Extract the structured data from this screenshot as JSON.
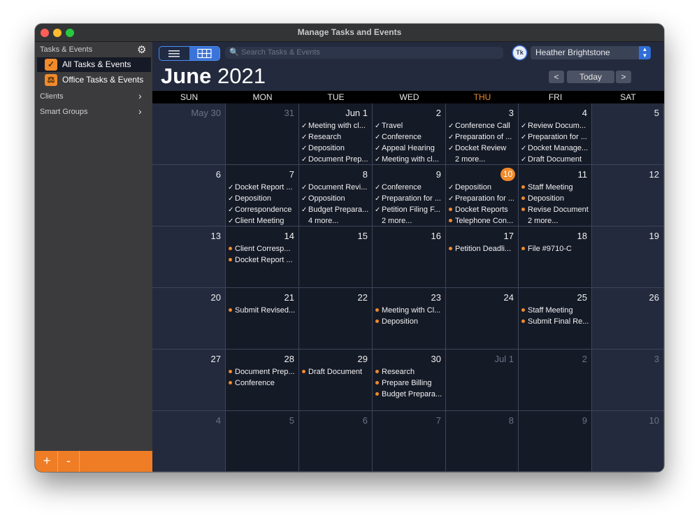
{
  "window": {
    "title": "Manage Tasks and Events"
  },
  "sidebar": {
    "header": "Tasks & Events",
    "items": [
      {
        "label": "All Tasks & Events",
        "icon": "checkbox-icon"
      },
      {
        "label": "Office Tasks & Events",
        "icon": "office-icon"
      }
    ],
    "groups": [
      {
        "label": "Clients"
      },
      {
        "label": "Smart Groups"
      }
    ],
    "add_label": "+",
    "remove_label": "-"
  },
  "toolbar": {
    "search_placeholder": "Search Tasks & Events",
    "user": "Heather Brightstone",
    "avatar_initials": "Tk",
    "today_label": "Today",
    "prev_label": "<",
    "next_label": ">"
  },
  "calendar": {
    "month": "June",
    "year": "2021",
    "weekdays": [
      "SUN",
      "MON",
      "TUE",
      "WED",
      "THU",
      "FRI",
      "SAT"
    ],
    "today_weekday_index": 4,
    "accent_color": "#f08a2b",
    "weeks": [
      [
        {
          "day": "May 30",
          "muted": true,
          "events": []
        },
        {
          "day": "31",
          "muted": true,
          "events": []
        },
        {
          "day": "Jun 1",
          "events": [
            {
              "text": "Meeting with cl...",
              "done": true
            },
            {
              "text": "Research",
              "done": true
            },
            {
              "text": "Deposition",
              "done": true
            },
            {
              "text": "Document Prep...",
              "done": true
            }
          ]
        },
        {
          "day": "2",
          "events": [
            {
              "text": "Travel",
              "done": true
            },
            {
              "text": "Conference",
              "done": true
            },
            {
              "text": "Appeal Hearing",
              "done": true
            },
            {
              "text": "Meeting with cl...",
              "done": true
            }
          ]
        },
        {
          "day": "3",
          "events": [
            {
              "text": "Conference Call",
              "done": true
            },
            {
              "text": "Preparation of ...",
              "done": true
            },
            {
              "text": "Docket Review",
              "done": true
            },
            {
              "text": "2 more...",
              "more": true
            }
          ]
        },
        {
          "day": "4",
          "events": [
            {
              "text": "Review Docum...",
              "done": true
            },
            {
              "text": "Preparation for ...",
              "done": true
            },
            {
              "text": "Docket Manage...",
              "done": true
            },
            {
              "text": "Draft Document",
              "done": true
            }
          ]
        },
        {
          "day": "5",
          "events": []
        }
      ],
      [
        {
          "day": "6",
          "events": []
        },
        {
          "day": "7",
          "events": [
            {
              "text": "Docket Report ...",
              "done": true
            },
            {
              "text": "Deposition",
              "done": true
            },
            {
              "text": "Correspondence",
              "done": true
            },
            {
              "text": "Client Meeting",
              "done": true
            }
          ]
        },
        {
          "day": "8",
          "events": [
            {
              "text": "Document Revi...",
              "done": true
            },
            {
              "text": "Opposition",
              "done": true
            },
            {
              "text": "Budget Prepara...",
              "done": true
            },
            {
              "text": "4 more...",
              "more": true
            }
          ]
        },
        {
          "day": "9",
          "events": [
            {
              "text": "Conference",
              "done": true
            },
            {
              "text": "Preparation for ...",
              "done": true
            },
            {
              "text": "Petition Filing F...",
              "done": true
            },
            {
              "text": "2 more...",
              "more": true
            }
          ]
        },
        {
          "day": "10",
          "today": true,
          "events": [
            {
              "text": "Deposition",
              "done": true
            },
            {
              "text": "Preparation for ...",
              "done": true
            },
            {
              "text": "Docket Reports",
              "done": false
            },
            {
              "text": "Telephone Con...",
              "done": false
            }
          ]
        },
        {
          "day": "11",
          "events": [
            {
              "text": "Staff Meeting",
              "done": false
            },
            {
              "text": "Deposition",
              "done": false
            },
            {
              "text": "Revise Document",
              "done": false
            },
            {
              "text": "2 more...",
              "more": true
            }
          ]
        },
        {
          "day": "12",
          "events": []
        }
      ],
      [
        {
          "day": "13",
          "events": []
        },
        {
          "day": "14",
          "events": [
            {
              "text": "Client Corresp...",
              "done": false
            },
            {
              "text": "Docket Report ...",
              "done": false
            }
          ]
        },
        {
          "day": "15",
          "events": []
        },
        {
          "day": "16",
          "events": []
        },
        {
          "day": "17",
          "events": [
            {
              "text": "Petition Deadli...",
              "done": false
            }
          ]
        },
        {
          "day": "18",
          "events": [
            {
              "text": "File #9710-C",
              "done": false
            }
          ]
        },
        {
          "day": "19",
          "events": []
        }
      ],
      [
        {
          "day": "20",
          "events": []
        },
        {
          "day": "21",
          "events": [
            {
              "text": "Submit Revised...",
              "done": false
            }
          ]
        },
        {
          "day": "22",
          "events": []
        },
        {
          "day": "23",
          "events": [
            {
              "text": "Meeting with Cl...",
              "done": false
            },
            {
              "text": "Deposition",
              "done": false
            }
          ]
        },
        {
          "day": "24",
          "events": []
        },
        {
          "day": "25",
          "events": [
            {
              "text": "Staff Meeting",
              "done": false
            },
            {
              "text": "Submit Final Re...",
              "done": false
            }
          ]
        },
        {
          "day": "26",
          "events": []
        }
      ],
      [
        {
          "day": "27",
          "events": []
        },
        {
          "day": "28",
          "events": [
            {
              "text": "Document Prep...",
              "done": false
            },
            {
              "text": "Conference",
              "done": false
            }
          ]
        },
        {
          "day": "29",
          "events": [
            {
              "text": "Draft Document",
              "done": false
            }
          ]
        },
        {
          "day": "30",
          "events": [
            {
              "text": "Research",
              "done": false
            },
            {
              "text": "Prepare Billing",
              "done": false
            },
            {
              "text": "Budget Prepara...",
              "done": false
            }
          ]
        },
        {
          "day": "Jul 1",
          "muted": true,
          "events": []
        },
        {
          "day": "2",
          "muted": true,
          "events": []
        },
        {
          "day": "3",
          "muted": true,
          "events": []
        }
      ],
      [
        {
          "day": "4",
          "muted": true,
          "events": []
        },
        {
          "day": "5",
          "muted": true,
          "events": []
        },
        {
          "day": "6",
          "muted": true,
          "events": []
        },
        {
          "day": "7",
          "muted": true,
          "events": []
        },
        {
          "day": "8",
          "muted": true,
          "events": []
        },
        {
          "day": "9",
          "muted": true,
          "events": []
        },
        {
          "day": "10",
          "muted": true,
          "events": []
        }
      ]
    ]
  }
}
